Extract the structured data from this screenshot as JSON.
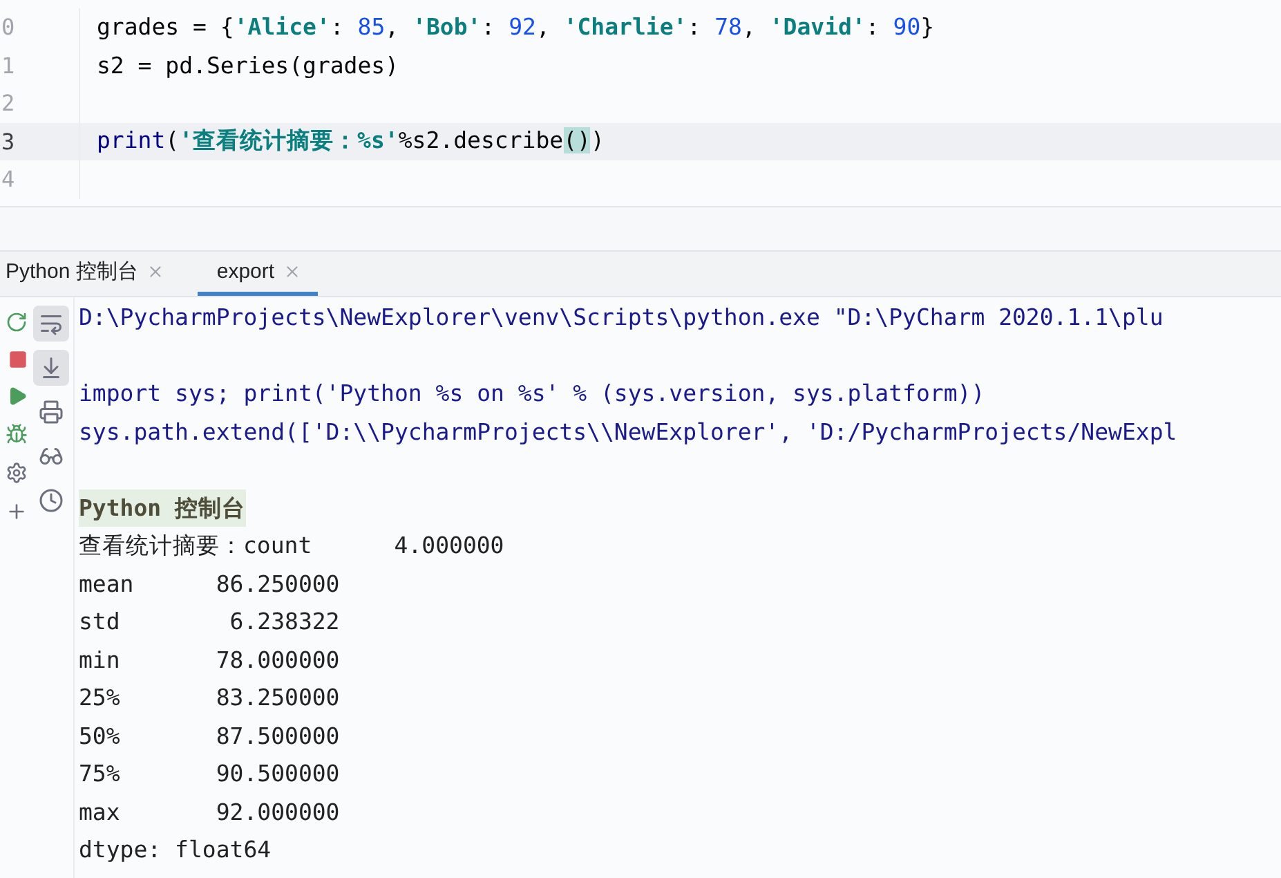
{
  "editor": {
    "lines": [
      {
        "number": "0",
        "current": false,
        "tokens": [
          {
            "kind": "plain",
            "text": "grades = {"
          },
          {
            "kind": "string",
            "text": "'Alice'"
          },
          {
            "kind": "plain",
            "text": ": "
          },
          {
            "kind": "number",
            "text": "85"
          },
          {
            "kind": "plain",
            "text": ", "
          },
          {
            "kind": "string",
            "text": "'Bob'"
          },
          {
            "kind": "plain",
            "text": ": "
          },
          {
            "kind": "number",
            "text": "92"
          },
          {
            "kind": "plain",
            "text": ", "
          },
          {
            "kind": "string",
            "text": "'Charlie'"
          },
          {
            "kind": "plain",
            "text": ": "
          },
          {
            "kind": "number",
            "text": "78"
          },
          {
            "kind": "plain",
            "text": ", "
          },
          {
            "kind": "string",
            "text": "'David'"
          },
          {
            "kind": "plain",
            "text": ": "
          },
          {
            "kind": "number",
            "text": "90"
          },
          {
            "kind": "plain",
            "text": "}"
          }
        ]
      },
      {
        "number": "1",
        "current": false,
        "tokens": [
          {
            "kind": "plain",
            "text": "s2 = pd.Series(grades)"
          }
        ]
      },
      {
        "number": "2",
        "current": false
      },
      {
        "number": "3",
        "current": true,
        "tokens": [
          {
            "kind": "builtin",
            "text": "print"
          },
          {
            "kind": "plain",
            "text": "("
          },
          {
            "kind": "string",
            "text": "'查看统计摘要：%s'"
          },
          {
            "kind": "plain",
            "text": "%s2.describe"
          },
          {
            "kind": "match",
            "text": "()"
          },
          {
            "kind": "plain",
            "text": ")"
          }
        ]
      },
      {
        "number": "4",
        "current": false
      }
    ]
  },
  "tabs": [
    {
      "label": "Python 控制台",
      "selected": false
    },
    {
      "label": "export",
      "selected": true
    }
  ],
  "run_toolbar": [
    {
      "kind": "rerun"
    },
    {
      "kind": "stop"
    },
    {
      "kind": "run"
    },
    {
      "kind": "debug"
    },
    {
      "kind": "settings"
    },
    {
      "kind": "add"
    }
  ],
  "console_toolbar": [
    {
      "kind": "wrap",
      "selected": true
    },
    {
      "kind": "scroll-end",
      "selected": true
    },
    {
      "kind": "print",
      "selected": false
    },
    {
      "kind": "inspect",
      "selected": false
    },
    {
      "kind": "history",
      "selected": false
    }
  ],
  "console": [
    {
      "kind": "command",
      "text": "D:\\PycharmProjects\\NewExplorer\\venv\\Scripts\\python.exe \"D:\\PyCharm 2020.1.1\\plu"
    },
    {
      "kind": "blank"
    },
    {
      "kind": "command",
      "text": "import sys; print('Python %s on %s' % (sys.version, sys.platform))"
    },
    {
      "kind": "command",
      "text": "sys.path.extend(['D:\\\\PycharmProjects\\\\NewExplorer', 'D:/PycharmProjects/NewExpl"
    },
    {
      "kind": "blank"
    },
    {
      "kind": "header",
      "text": "Python 控制台"
    },
    {
      "kind": "output",
      "text": "查看统计摘要：count      4.000000"
    },
    {
      "kind": "output",
      "text": "mean      86.250000"
    },
    {
      "kind": "output",
      "text": "std        6.238322"
    },
    {
      "kind": "output",
      "text": "min       78.000000"
    },
    {
      "kind": "output",
      "text": "25%       83.250000"
    },
    {
      "kind": "output",
      "text": "50%       87.500000"
    },
    {
      "kind": "output",
      "text": "75%       90.500000"
    },
    {
      "kind": "output",
      "text": "max       92.000000"
    },
    {
      "kind": "output",
      "text": "dtype: float64"
    }
  ]
}
